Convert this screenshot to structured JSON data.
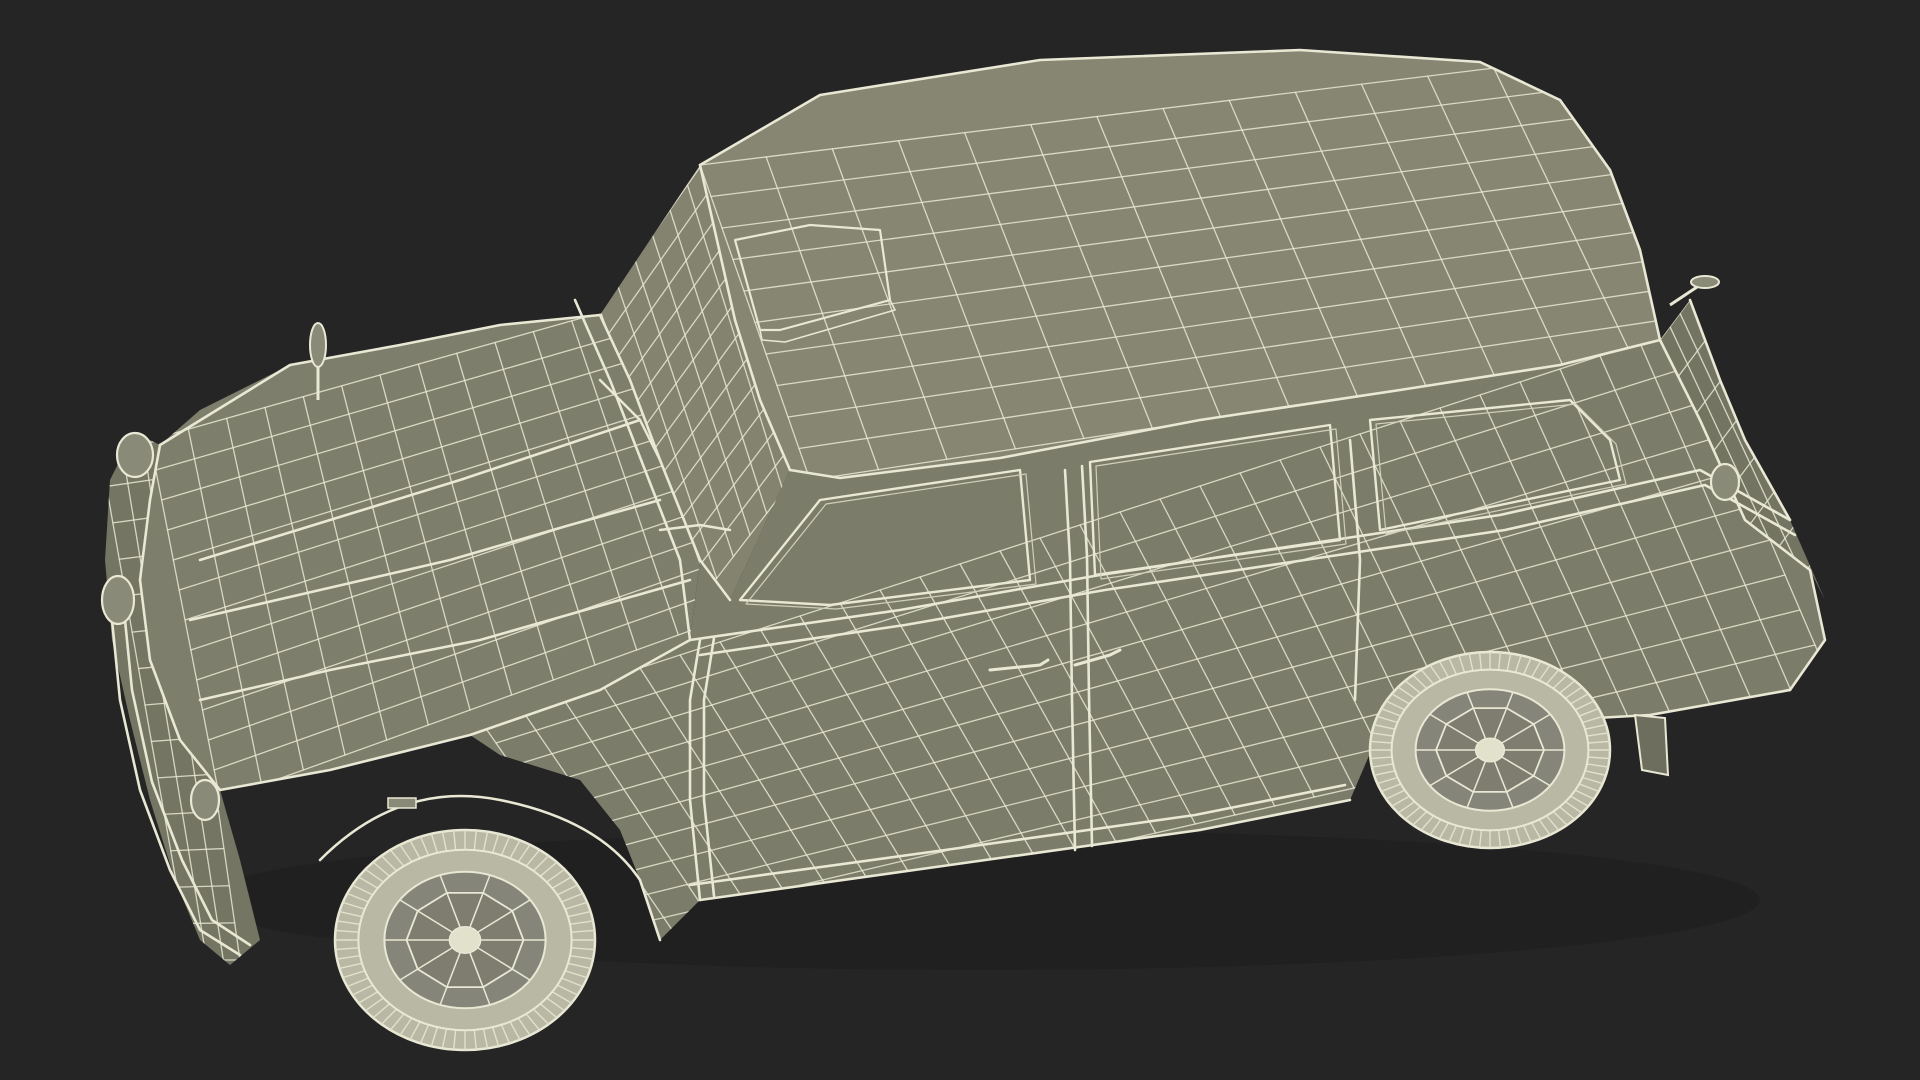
{
  "scene": {
    "background": "#252525",
    "subject": "car-wireframe-model",
    "colors": {
      "body_fill": "#7e7e6c",
      "body_fill_light": "#8a8a78",
      "body_fill_dark": "#6e6e5e",
      "wire": "#e9e8d4",
      "wire_dim": "#cfcfbb",
      "tire": "#e2e1cc",
      "tire_dark": "#b9b8a4"
    },
    "icons": {
      "mirror": "side-mirror-icon",
      "wheel": "wheel-icon"
    }
  }
}
